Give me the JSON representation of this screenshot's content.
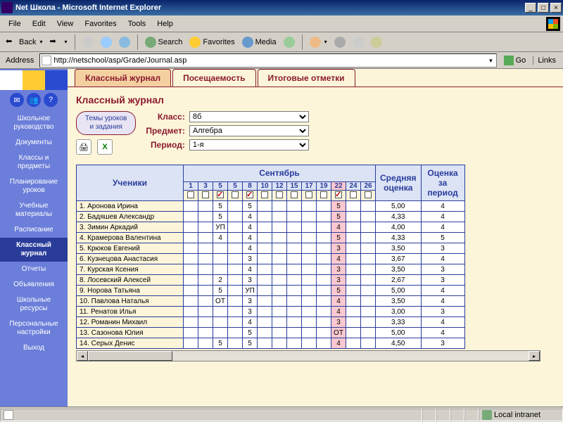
{
  "window": {
    "title": "Net Школа - Microsoft Internet Explorer"
  },
  "menu": [
    "File",
    "Edit",
    "View",
    "Favorites",
    "Tools",
    "Help"
  ],
  "toolbar": {
    "back": "Back",
    "search": "Search",
    "favorites": "Favorites",
    "media": "Media"
  },
  "address": {
    "label": "Address",
    "value": "http://netschool/asp/Grade/Journal.asp",
    "go": "Go",
    "links": "Links"
  },
  "sidebar": {
    "icons": [
      "✉",
      "👥",
      "?"
    ],
    "items": [
      "Школьное руководство",
      "Документы",
      "Классы и предметы",
      "Планирование уроков",
      "Учебные материалы",
      "Расписание",
      "Классный журнал",
      "Отчеты",
      "Объявления",
      "Школьные ресурсы",
      "Персональные настройки",
      "Выход"
    ],
    "active_index": 6
  },
  "tabs": {
    "items": [
      "Классный журнал",
      "Посещаемость",
      "Итоговые отметки"
    ],
    "active": 0
  },
  "page": {
    "title": "Классный журнал"
  },
  "lessons_btn": {
    "l1": "Темы уроков",
    "l2": "и задания"
  },
  "filters": {
    "class_label": "Класс:",
    "class_value": "8б",
    "subject_label": "Предмет:",
    "subject_value": "Алгебра",
    "period_label": "Период:",
    "period_value": "1-я"
  },
  "grid": {
    "students_header": "Ученики",
    "month": "Сентябрь",
    "avg_header": "Средняя оценка",
    "period_header_l1": "Оценка",
    "period_header_l2": "за",
    "period_header_l3": "период",
    "days": [
      1,
      3,
      5,
      5,
      8,
      10,
      12,
      15,
      17,
      19,
      22,
      24,
      26
    ],
    "checked_days": [
      2,
      4,
      10
    ],
    "highlight_col": 10,
    "students": [
      {
        "n": 1,
        "name": "Аронова Ирина",
        "marks": {
          "2": "5",
          "4": "5",
          "10": "5"
        },
        "avg": "5,00",
        "per": "4"
      },
      {
        "n": 2,
        "name": "Бадяшев Александр",
        "marks": {
          "2": "5",
          "4": "4",
          "10": "5"
        },
        "avg": "4,33",
        "per": "4"
      },
      {
        "n": 3,
        "name": "Зимин Аркадий",
        "marks": {
          "2": "УП",
          "4": "4",
          "10": "4"
        },
        "avg": "4,00",
        "per": "4"
      },
      {
        "n": 4,
        "name": "Крамерова Валентина",
        "marks": {
          "2": "4",
          "4": "4",
          "10": "5"
        },
        "avg": "4,33",
        "per": "5"
      },
      {
        "n": 5,
        "name": "Крюков Евгений",
        "marks": {
          "4": "4",
          "10": "3"
        },
        "avg": "3,50",
        "per": "3"
      },
      {
        "n": 6,
        "name": "Кузнецова Анастасия",
        "marks": {
          "4": "3",
          "10": "4"
        },
        "avg": "3,67",
        "per": "4"
      },
      {
        "n": 7,
        "name": "Курская Ксения",
        "marks": {
          "4": "4",
          "10": "3"
        },
        "avg": "3,50",
        "per": "3"
      },
      {
        "n": 8,
        "name": "Лосевский Алексей",
        "marks": {
          "2": "2",
          "4": "3",
          "10": "3"
        },
        "avg": "2,67",
        "per": "3"
      },
      {
        "n": 9,
        "name": "Норова Татьяна",
        "marks": {
          "2": "5",
          "4": "УП",
          "10": "5"
        },
        "avg": "5,00",
        "per": "4"
      },
      {
        "n": 10,
        "name": "Павлова Наталья",
        "marks": {
          "2": "ОТ",
          "4": "3",
          "10": "4"
        },
        "avg": "3,50",
        "per": "4"
      },
      {
        "n": 11,
        "name": "Ренатов Илья",
        "marks": {
          "4": "3",
          "10": "4"
        },
        "avg": "3,00",
        "per": "3"
      },
      {
        "n": 12,
        "name": "Романин Михаил",
        "marks": {
          "4": "4",
          "10": "3"
        },
        "avg": "3,33",
        "per": "4"
      },
      {
        "n": 13,
        "name": "Сазонова Юлия",
        "marks": {
          "4": "5",
          "10": "ОТ"
        },
        "avg": "5,00",
        "per": "4"
      },
      {
        "n": 14,
        "name": "Серых Денис",
        "marks": {
          "2": "5",
          "4": "5",
          "10": "4"
        },
        "avg": "4,50",
        "per": "3"
      }
    ]
  },
  "status": {
    "zone": "Local intranet"
  }
}
